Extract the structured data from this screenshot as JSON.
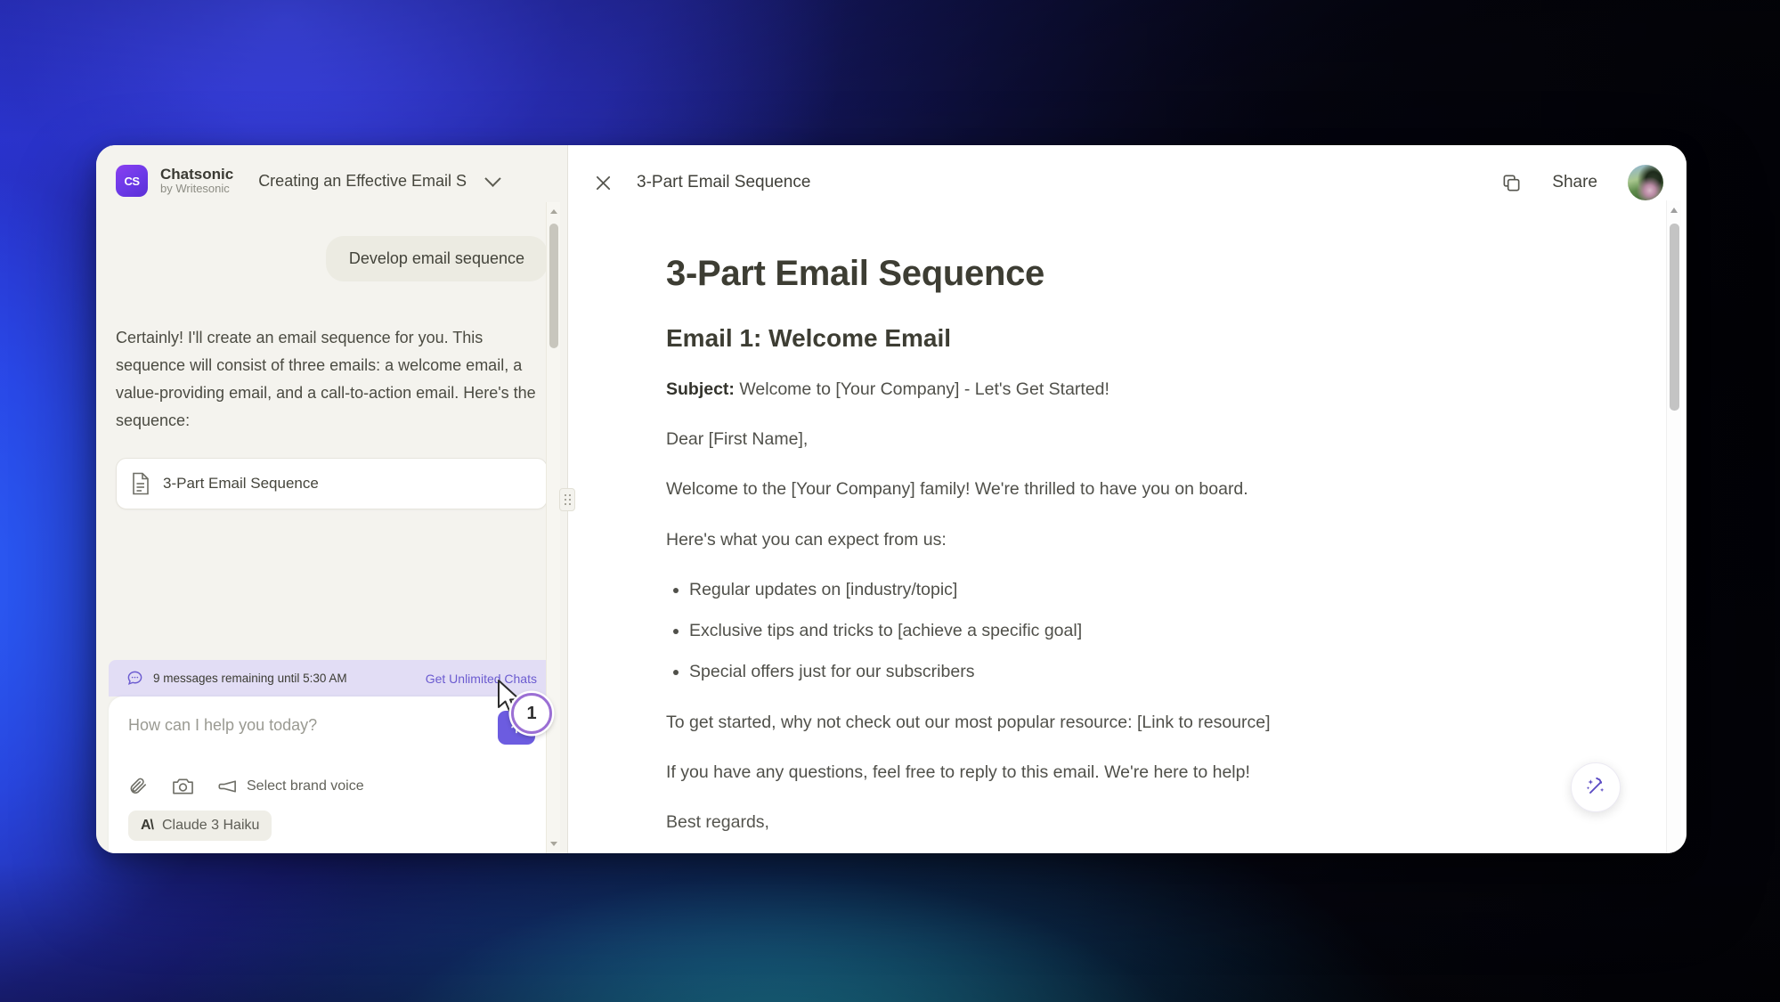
{
  "window": {
    "brand": {
      "name": "Chatsonic",
      "tagline": "by Writesonic",
      "logo_text": "CS"
    },
    "conversation_title": "Creating an Effective Email S"
  },
  "chat": {
    "user_message": "Develop email sequence",
    "assistant_message": "Certainly! I'll create an email sequence for you. This sequence will consist of three emails: a welcome email, a value-providing email, and a call-to-action email. Here's the sequence:",
    "document_card_title": "3-Part Email Sequence",
    "quota": {
      "text": "9 messages remaining until 5:30 AM",
      "link_label": "Get Unlimited Chats"
    },
    "composer": {
      "placeholder": "How can I help you today?",
      "brand_voice_label": "Select brand voice",
      "model_label": "Claude 3 Haiku",
      "model_mark": "A\\"
    },
    "annotation_step": "1"
  },
  "document": {
    "header_title": "3-Part Email Sequence",
    "share_label": "Share",
    "title": "3-Part Email Sequence",
    "section_heading": "Email 1: Welcome Email",
    "subject_label": "Subject:",
    "subject_value": " Welcome to [Your Company] - Let's Get Started!",
    "greeting": "Dear [First Name],",
    "intro": "Welcome to the [Your Company] family! We're thrilled to have you on board.",
    "expect_lead": "Here's what you can expect from us:",
    "bullets": [
      "Regular updates on [industry/topic]",
      "Exclusive tips and tricks to [achieve a specific goal]",
      "Special offers just for our subscribers"
    ],
    "cta": "To get started, why not check out our most popular resource: [Link to resource]",
    "support": "If you have any questions, feel free to reply to this email. We're here to help!",
    "signoff": "Best regards,"
  },
  "colors": {
    "brand_purple": "#6c5ce0",
    "link_purple": "#6b5bd0",
    "quota_bg": "#e2ddf5",
    "chat_bg": "#f4f3ee",
    "bubble_bg": "#ecebe2"
  }
}
